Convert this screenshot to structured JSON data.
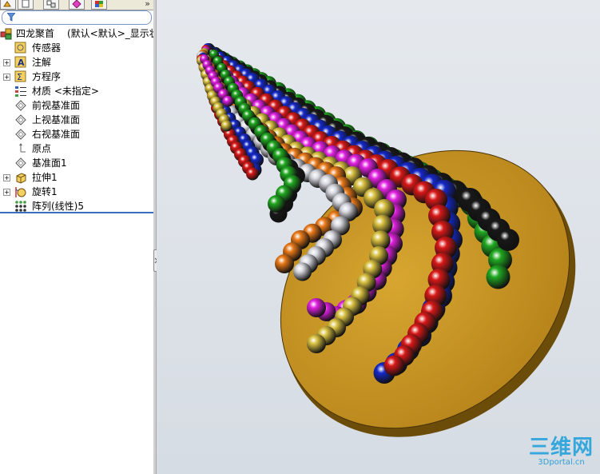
{
  "tree": {
    "part_name": "四龙聚首",
    "config": "(默认<默认>_显示状",
    "items": [
      {
        "label": "传感器",
        "icon": "sensor-icon"
      },
      {
        "label": "注解",
        "icon": "annotation-icon"
      },
      {
        "label": "方程序",
        "icon": "equation-icon"
      },
      {
        "label": "材质 <未指定>",
        "icon": "material-icon"
      },
      {
        "label": "前视基准面",
        "icon": "plane-icon"
      },
      {
        "label": "上视基准面",
        "icon": "plane-icon"
      },
      {
        "label": "右视基准面",
        "icon": "plane-icon"
      },
      {
        "label": "原点",
        "icon": "origin-icon"
      },
      {
        "label": "基准面1",
        "icon": "plane-icon"
      },
      {
        "label": "拉伸1",
        "icon": "extrude-icon"
      },
      {
        "label": "旋转1",
        "icon": "revolve-icon"
      },
      {
        "label": "阵列(线性)5",
        "icon": "linear-pattern-icon"
      }
    ]
  },
  "watermark": {
    "logo": "三维网",
    "url": "3Dportal.cn"
  },
  "colors": {
    "disc": "#c8961e",
    "disc_rim": "#6b4c08",
    "accent": "#3a6fc0"
  }
}
